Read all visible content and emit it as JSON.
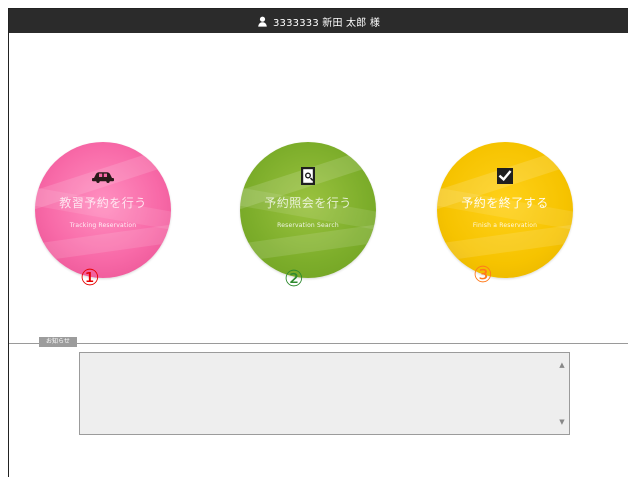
{
  "header": {
    "user_text": "3333333 新田 太郎 様",
    "user_icon": "user-icon"
  },
  "menu": {
    "items": [
      {
        "title": "教習予約を行う",
        "subtitle": "Tracking Reservation",
        "icon": "car-icon",
        "color": "#f86aa8"
      },
      {
        "title": "予約照会を行う",
        "subtitle": "Reservation Search",
        "icon": "document-search-icon",
        "color": "#7cad2a"
      },
      {
        "title": "予約を終了する",
        "subtitle": "Finish a Reservation",
        "icon": "checkbox-icon",
        "color": "#f6c300"
      }
    ]
  },
  "markers": [
    "①",
    "②",
    "③"
  ],
  "section": {
    "label": "お知らせ"
  },
  "message_box": {
    "value": "",
    "placeholder": ""
  }
}
